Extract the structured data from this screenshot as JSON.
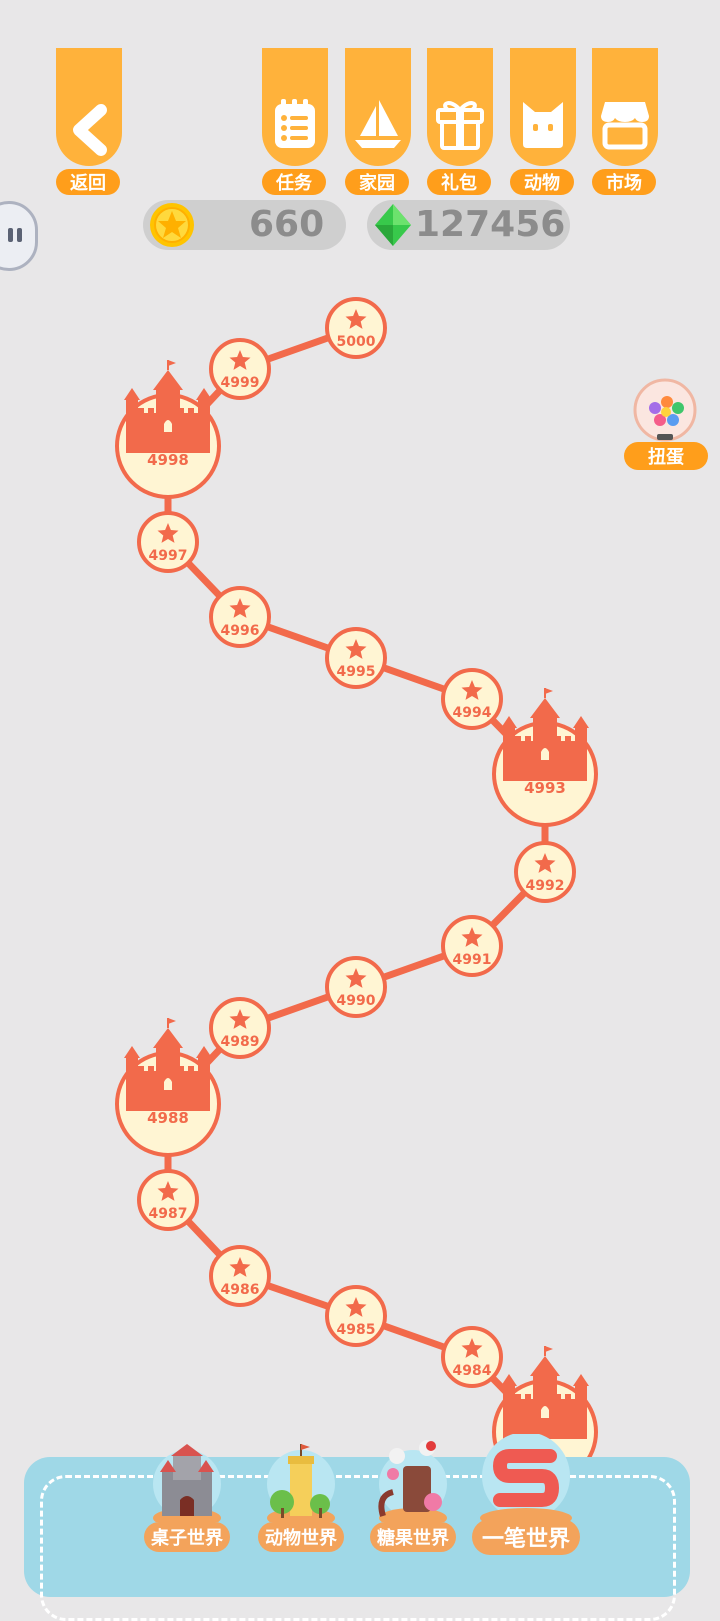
{
  "top_buttons": {
    "back": "返回",
    "tasks": "任务",
    "home": "家园",
    "gift": "礼包",
    "animals": "动物",
    "market": "市场"
  },
  "currency": {
    "coins": "660",
    "gems": "127456"
  },
  "gacha_label": "扭蛋",
  "levels": [
    {
      "label": "5000",
      "castle": false
    },
    {
      "label": "4999",
      "castle": false
    },
    {
      "label": "4998",
      "castle": true
    },
    {
      "label": "4997",
      "castle": false
    },
    {
      "label": "4996",
      "castle": false
    },
    {
      "label": "4995",
      "castle": false
    },
    {
      "label": "4994",
      "castle": false
    },
    {
      "label": "4993",
      "castle": true
    },
    {
      "label": "4992",
      "castle": false
    },
    {
      "label": "4991",
      "castle": false
    },
    {
      "label": "4990",
      "castle": false
    },
    {
      "label": "4989",
      "castle": false
    },
    {
      "label": "4988",
      "castle": true
    },
    {
      "label": "4987",
      "castle": false
    },
    {
      "label": "4986",
      "castle": false
    },
    {
      "label": "4985",
      "castle": false
    },
    {
      "label": "4984",
      "castle": false
    },
    {
      "label": "",
      "castle": true
    }
  ],
  "worlds": [
    {
      "label": "桌子世界",
      "icon": "gray-castle-icon"
    },
    {
      "label": "动物世界",
      "icon": "yellow-tower-icon"
    },
    {
      "label": "糖果世界",
      "icon": "candy-icon"
    },
    {
      "label": "一笔世界",
      "icon": "s-letter-icon"
    }
  ],
  "colors": {
    "accent": "#ffb23b",
    "path": "#f26a4b",
    "node_fill": "#fff5d3",
    "panel": "#9fd8e7"
  }
}
